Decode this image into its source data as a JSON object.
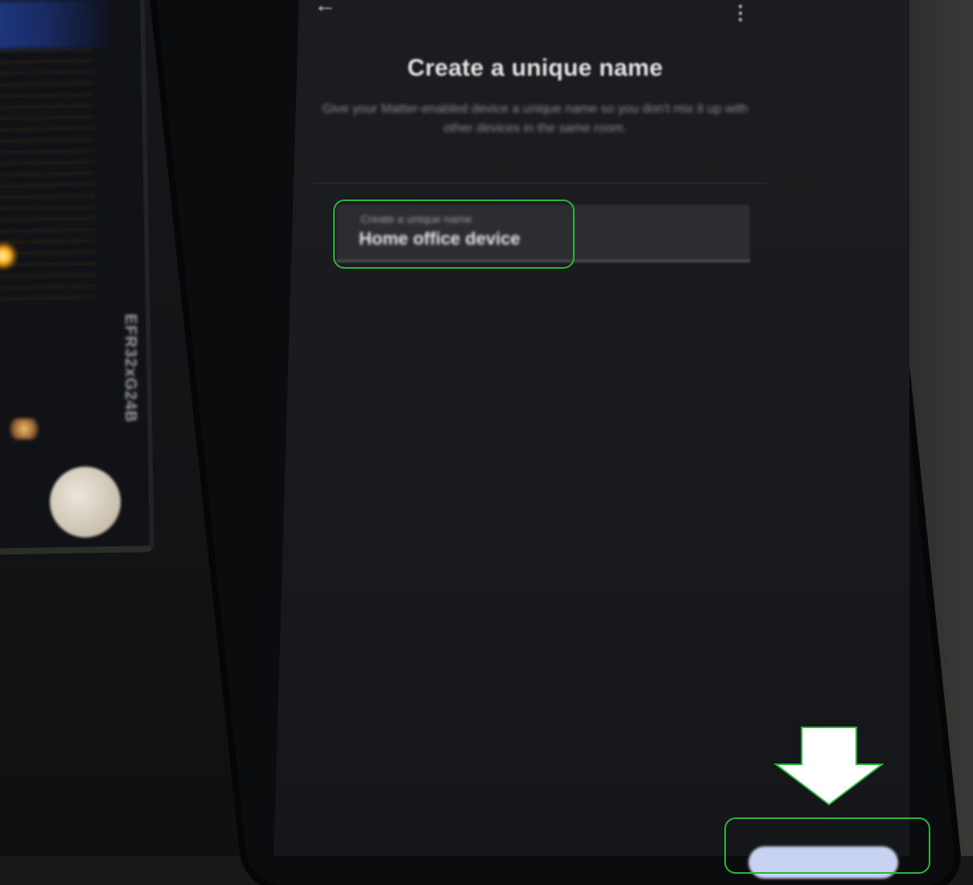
{
  "screen": {
    "title": "Create a unique name",
    "description": "Give your Matter-enabled device a unique name so you don't mix it up with other devices in the same room.",
    "name_field": {
      "label": "Create a unique name",
      "value": "Home office device"
    }
  },
  "background": {
    "board_label": "EFR32xG24B"
  },
  "colors": {
    "highlight": "#2ab33a",
    "pointer": "#ffffff",
    "primary_button": "#c8d3f2"
  },
  "icons": {
    "back": "arrow-left",
    "more": "vertical-ellipsis",
    "pointer": "down-arrow"
  }
}
